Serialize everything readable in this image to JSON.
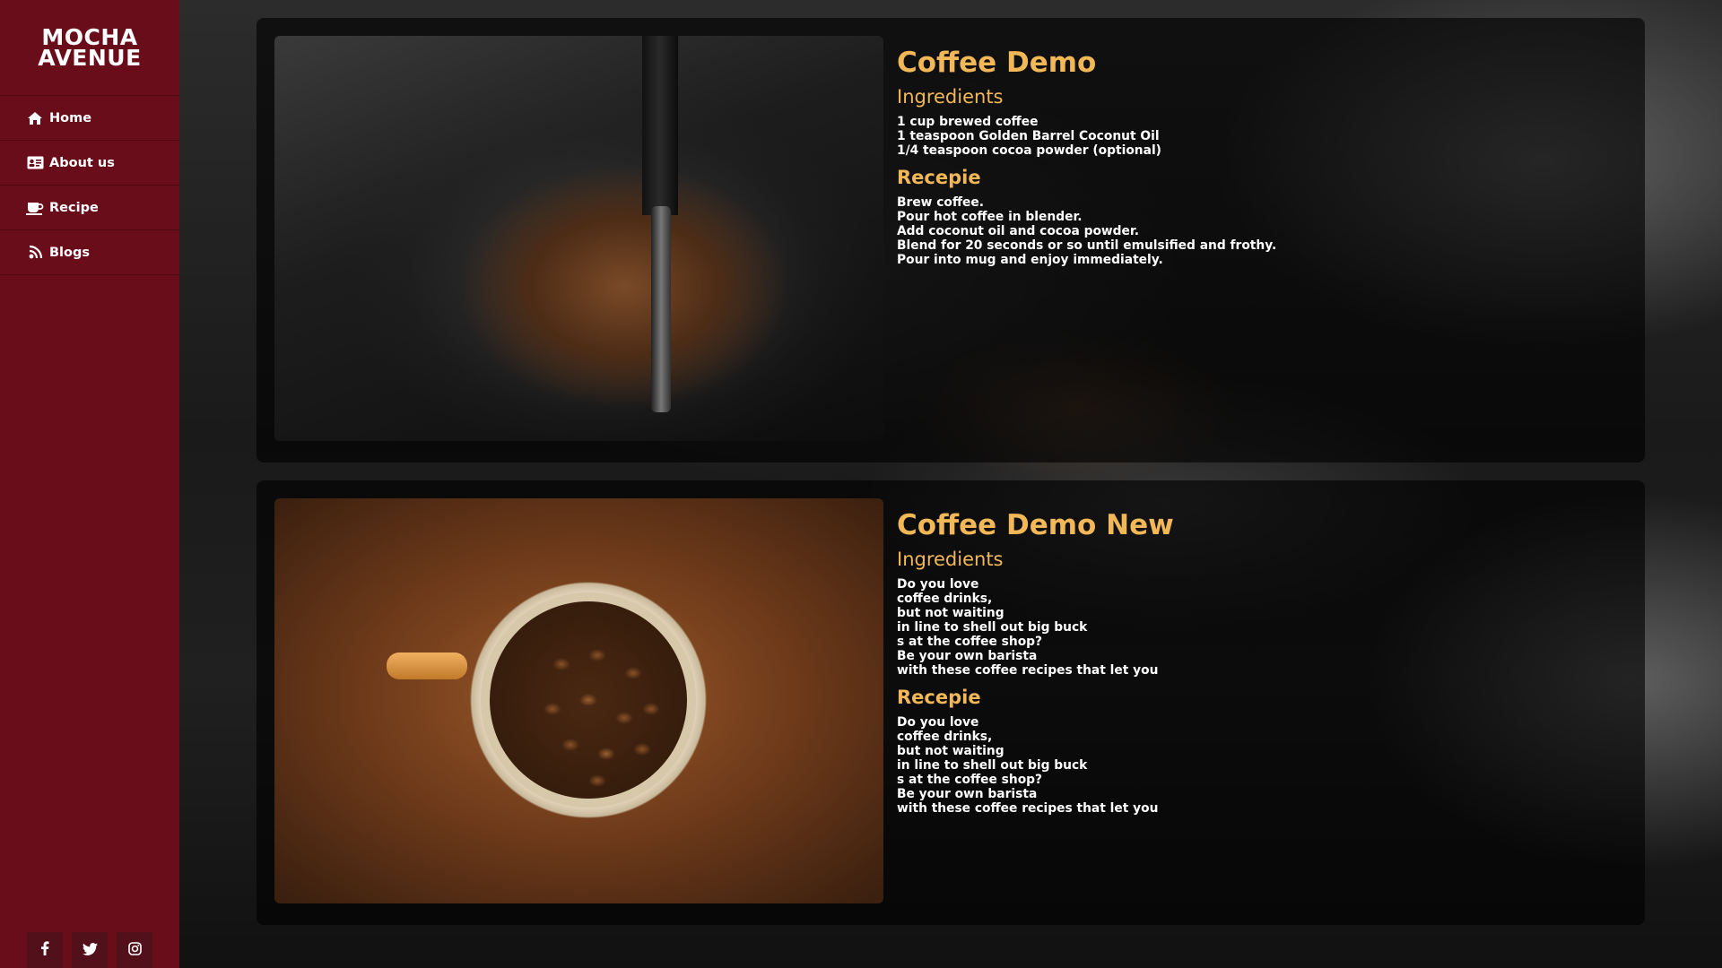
{
  "brand": {
    "line1": "MOCHA",
    "line2": "AVENUE"
  },
  "sidebar": {
    "items": [
      {
        "label": "Home",
        "icon": "home-icon"
      },
      {
        "label": "About us",
        "icon": "id-card-icon"
      },
      {
        "label": "Recipe",
        "icon": "coffee-cup-icon"
      },
      {
        "label": "Blogs",
        "icon": "blog-icon"
      }
    ]
  },
  "social": [
    "facebook-icon",
    "twitter-icon",
    "instagram-icon"
  ],
  "colors": {
    "sidebar": "#6a0d1a",
    "accent": "#f2b857"
  },
  "cards": [
    {
      "title": "Coffee Demo",
      "ingredients_label": "Ingredients",
      "ingredients": [
        "1 cup brewed coffee",
        "1 teaspoon Golden Barrel Coconut Oil",
        "1/4 teaspoon cocoa powder (optional)"
      ],
      "recipe_label": "Recepie",
      "recipe": [
        "Brew coffee.",
        "Pour hot coffee in blender.",
        "Add coconut oil and cocoa powder.",
        "Blend for 20 seconds or so until emulsified and frothy.",
        "Pour into mug and enjoy immediately."
      ]
    },
    {
      "title": "Coffee Demo New",
      "ingredients_label": "Ingredients",
      "ingredients": [
        "Do you love",
        "coffee drinks,",
        "but not waiting",
        "in line to shell out big buck",
        "s at the coffee shop?",
        "Be your own barista",
        "with these coffee recipes that let you"
      ],
      "recipe_label": "Recepie",
      "recipe": [
        "Do you love",
        "coffee drinks,",
        "but not waiting",
        "in line to shell out big buck",
        "s at the coffee shop?",
        "Be your own barista",
        "with these coffee recipes that let you"
      ]
    }
  ]
}
